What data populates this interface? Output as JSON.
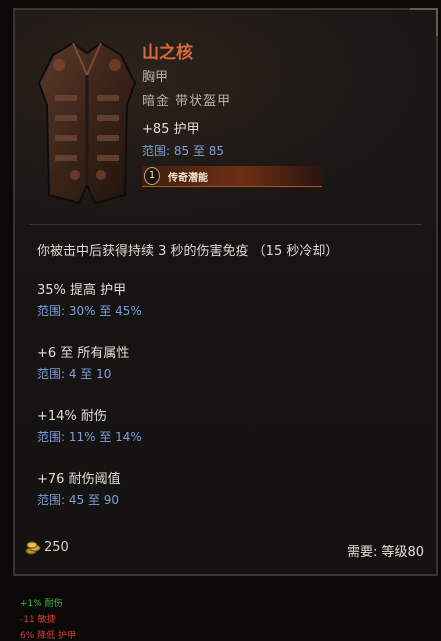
{
  "item": {
    "name": "山之核",
    "slot": "胸甲",
    "type": "暗金 带状盔甲",
    "base_stat": "+85 护甲",
    "base_range": "范围: 85 至 85",
    "legendary_rank": "1",
    "legendary_label": "传奇潜能"
  },
  "effect": "你被击中后获得持续 3 秒的伤害免疫 （15 秒冷却）",
  "affixes": [
    {
      "value": "35% 提高 护甲",
      "range": "范围: 30% 至 45%"
    },
    {
      "value": "+6 至 所有属性",
      "range": "范围: 4 至 10"
    },
    {
      "value": "+14% 耐伤",
      "range": "范围: 11% 至 14%"
    },
    {
      "value": "+76 耐伤阈值",
      "range": "范围: 45 至 90"
    }
  ],
  "footer": {
    "gold": "250",
    "requirement": "需要: 等级80"
  },
  "comparison": [
    {
      "text": "+1% 耐伤",
      "color": "#3fbf3f"
    },
    {
      "text": "-11 敏捷",
      "color": "#d04030"
    },
    {
      "text": "6% 降低 护甲",
      "color": "#d04030"
    }
  ],
  "colors": {
    "legendary_name": "#d86a3c",
    "range_text": "#7f9ed8",
    "positive": "#3fbf3f",
    "negative": "#d04030"
  }
}
